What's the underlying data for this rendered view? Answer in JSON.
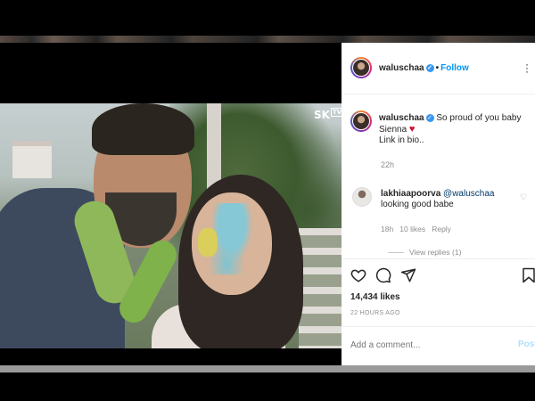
{
  "post": {
    "author": "waluschaa",
    "follow_label": "Follow",
    "dot": "•",
    "more_icon": "more-horizontal-icon"
  },
  "media": {
    "watermark": "SK",
    "watermark_sub": "TV"
  },
  "caption": {
    "author": "waluschaa",
    "text_line1": "So proud of you baby",
    "text_line2": "Sienna",
    "heart": "♥",
    "text_line3": "Link in bio..",
    "time": "22h"
  },
  "comment": {
    "author": "lakhiaapoorva",
    "mention": "@waluschaa",
    "text": "looking good babe",
    "time": "18h",
    "likes": "10 likes",
    "reply_label": "Reply",
    "view_replies": "View replies (1)"
  },
  "footer": {
    "likes": "14,434 likes",
    "ago": "22 HOURS AGO",
    "comment_placeholder": "Add a comment...",
    "post_label": "Post"
  },
  "colors": {
    "accent": "#0095f6",
    "verified": "#3897f0",
    "heart": "#d1102d"
  }
}
